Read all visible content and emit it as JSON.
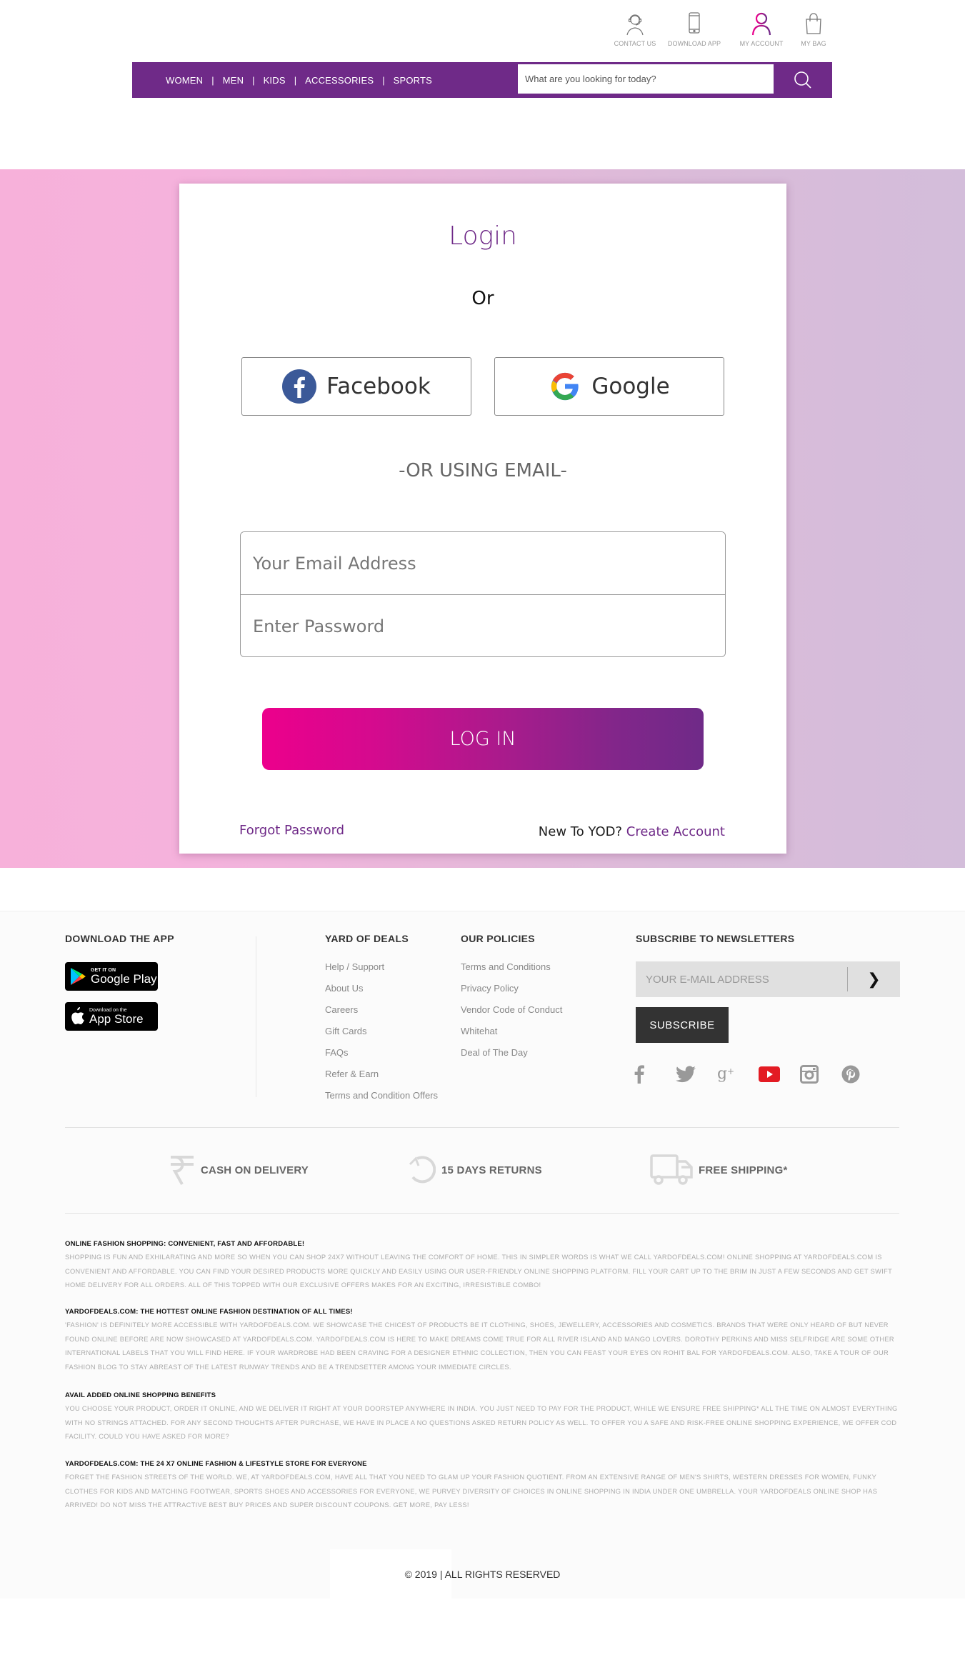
{
  "header": {
    "top_icons": [
      {
        "icon": "headset-icon",
        "label": "CONTACT US"
      },
      {
        "icon": "smartphone-icon",
        "label": "DOWNLOAD APP"
      },
      {
        "icon": "user-icon",
        "label": "MY ACCOUNT"
      },
      {
        "icon": "shopping-bag-icon",
        "label": "MY BAG"
      }
    ],
    "nav": [
      "WOMEN",
      "MEN",
      "KIDS",
      "ACCESSORIES",
      "SPORTS"
    ],
    "search_placeholder": "What are you looking for today?",
    "search_icon": "search-icon"
  },
  "colors": {
    "brand_purple": "#6f2a88",
    "brand_pink": "#ec008c",
    "youtube_red": "#e31b23"
  },
  "login": {
    "title": "Login",
    "or": "Or",
    "facebook_label": "Facebook",
    "google_label": "Google",
    "or_email": "-OR USING EMAIL-",
    "email_placeholder": "Your Email Address",
    "password_placeholder": "Enter Password",
    "login_button": "LOG IN",
    "forgot_password": "Forgot Password",
    "new_to": "New To YOD?",
    "create_account": "Create Account"
  },
  "footer": {
    "download_heading": "DOWNLOAD THE APP",
    "google_play": {
      "small": "GET IT ON",
      "big": "Google Play"
    },
    "app_store": {
      "small": "Download on the",
      "big": "App Store"
    },
    "yod_heading": "YARD OF DEALS",
    "yod_links": [
      "Help / Support",
      "About Us",
      "Careers",
      "Gift Cards",
      "FAQs",
      "Refer & Earn",
      "Terms and Condition Offers"
    ],
    "policies_heading": "OUR POLICIES",
    "policies_links": [
      "Terms and Conditions",
      "Privacy Policy",
      "Vendor Code of Conduct",
      "Whitehat",
      "Deal of The Day"
    ],
    "newsletter_heading": "SUBSCRIBE TO NEWSLETTERS",
    "newsletter_placeholder": "YOUR E-MAIL ADDRESS",
    "newsletter_arrow": "❯",
    "subscribe_label": "SUBSCRIBE",
    "social": [
      "facebook-icon",
      "twitter-icon",
      "google-plus-icon",
      "youtube-icon",
      "instagram-icon",
      "pinterest-icon"
    ],
    "usps": [
      {
        "icon": "rupee-icon",
        "label": "CASH ON DELIVERY"
      },
      {
        "icon": "returns-icon",
        "label": "15 DAYS RETURNS"
      },
      {
        "icon": "truck-icon",
        "label": "FREE SHIPPING*"
      }
    ],
    "seo": [
      {
        "title": "ONLINE FASHION SHOPPING: CONVENIENT, FAST AND AFFORDABLE!",
        "body": "SHOPPING IS FUN AND EXHILARATING AND MORE SO WHEN YOU CAN SHOP 24X7 WITHOUT LEAVING THE COMFORT OF HOME. THIS IN SIMPLER WORDS IS WHAT WE CALL YARDOFDEALS.COM! ONLINE SHOPPING AT YARDOFDEALS.COM IS CONVENIENT AND AFFORDABLE. YOU CAN FIND YOUR DESIRED PRODUCTS MORE QUICKLY AND EASILY USING OUR USER-FRIENDLY ONLINE SHOPPING PLATFORM. FILL YOUR CART UP TO THE BRIM IN JUST A FEW SECONDS AND GET SWIFT HOME DELIVERY FOR ALL ORDERS. ALL OF THIS TOPPED WITH OUR EXCLUSIVE OFFERS MAKES FOR AN EXCITING, IRRESISTIBLE COMBO!"
      },
      {
        "title": "YARDOFDEALS.COM: THE HOTTEST ONLINE FASHION DESTINATION OF ALL TIMES!",
        "body": "'FASHION' IS DEFINITELY MORE ACCESSIBLE WITH YARDOFDEALS.COM. WE SHOWCASE THE CHICEST OF PRODUCTS BE IT CLOTHING, SHOES, JEWELLERY, ACCESSORIES AND COSMETICS. BRANDS THAT WERE ONLY HEARD OF BUT NEVER FOUND ONLINE BEFORE ARE NOW SHOWCASED AT YARDOFDEALS.COM. YARDOFDEALS.COM IS HERE TO MAKE DREAMS COME TRUE FOR ALL RIVER ISLAND AND MANGO LOVERS. DOROTHY PERKINS AND MISS SELFRIDGE ARE SOME OTHER INTERNATIONAL LABELS THAT YOU WILL FIND HERE. IF YOUR WARDROBE HAD BEEN CRAVING FOR A DESIGNER ETHNIC COLLECTION, THEN YOU CAN FEAST YOUR EYES ON ROHIT BAL FOR YARDOFDEALS.COM. ALSO, TAKE A TOUR OF OUR FASHION BLOG TO STAY ABREAST OF THE LATEST RUNWAY TRENDS AND BE A TRENDSETTER AMONG YOUR IMMEDIATE CIRCLES."
      },
      {
        "title": "AVAIL ADDED ONLINE SHOPPING BENEFITS",
        "body": "YOU CHOOSE YOUR PRODUCT, ORDER IT ONLINE, AND WE DELIVER IT RIGHT AT YOUR DOORSTEP ANYWHERE IN INDIA. YOU JUST NEED TO PAY FOR THE PRODUCT, WHILE WE ENSURE FREE SHIPPING* ALL THE TIME ON ALMOST EVERYTHING WITH NO STRINGS ATTACHED. FOR ANY SECOND THOUGHTS AFTER PURCHASE, WE HAVE IN PLACE A NO QUESTIONS ASKED RETURN POLICY AS WELL. TO OFFER YOU A SAFE AND RISK-FREE ONLINE SHOPPING EXPERIENCE, WE OFFER COD FACILITY. COULD YOU HAVE ASKED FOR MORE?"
      },
      {
        "title": "YARDOFDEALS.COM: THE 24 X7 ONLINE FASHION & LIFESTYLE STORE FOR EVERYONE",
        "body": "FORGET THE FASHION STREETS OF THE WORLD. WE, AT YARDOFDEALS.COM, HAVE ALL THAT YOU NEED TO GLAM UP YOUR FASHION QUOTIENT. FROM AN EXTENSIVE RANGE OF MEN'S SHIRTS, WESTERN DRESSES FOR WOMEN, FUNKY CLOTHES FOR KIDS AND MATCHING FOOTWEAR, SPORTS SHOES AND ACCESSORIES FOR EVERYONE, WE PURVEY DIVERSITY OF CHOICES IN ONLINE SHOPPING IN INDIA UNDER ONE UMBRELLA. YOUR YARDOFDEALS ONLINE SHOP HAS ARRIVED! DO NOT MISS THE ATTRACTIVE BEST BUY PRICES AND SUPER DISCOUNT COUPONS. GET MORE, PAY LESS!"
      }
    ],
    "copyright": "© 2019 | ALL RIGHTS RESERVED"
  }
}
